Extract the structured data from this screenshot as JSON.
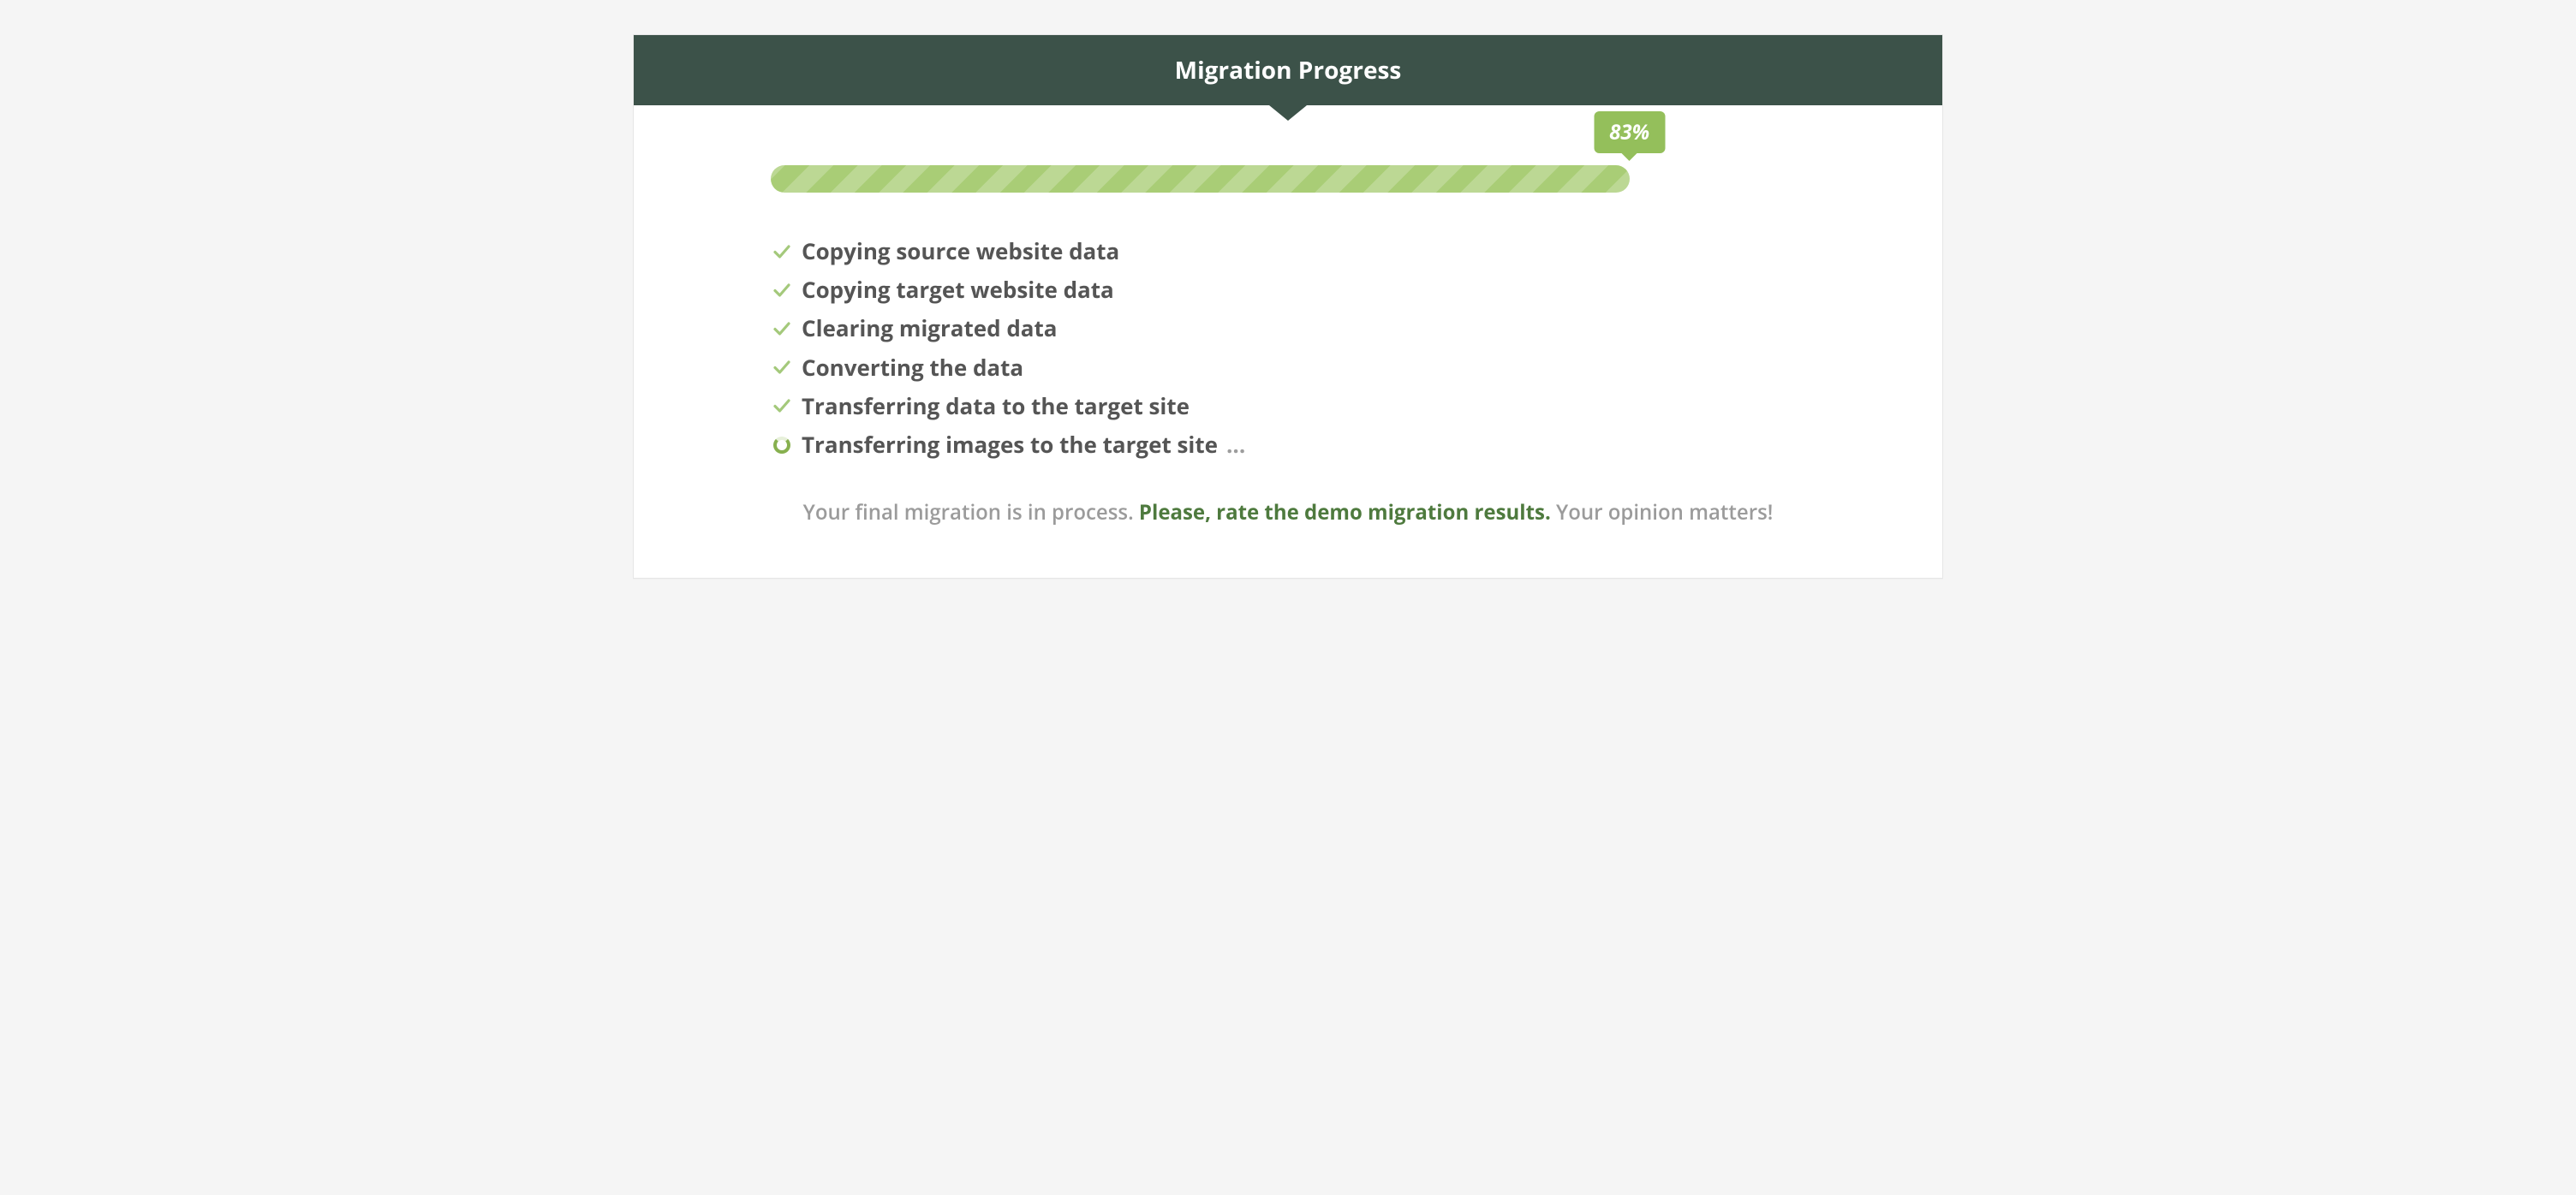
{
  "header": {
    "title": "Migration Progress"
  },
  "progress": {
    "percent": 83,
    "badge_text": "83%"
  },
  "steps": [
    {
      "status": "done",
      "label": "Copying source website data"
    },
    {
      "status": "done",
      "label": "Copying target website data"
    },
    {
      "status": "done",
      "label": "Clearing migrated data"
    },
    {
      "status": "done",
      "label": "Converting the data"
    },
    {
      "status": "done",
      "label": "Transferring data to the target site"
    },
    {
      "status": "running",
      "label": "Transferring images to the target site",
      "ellipsis": "..."
    }
  ],
  "footer": {
    "lead": "Your final migration is in process. ",
    "link": "Please, rate the demo migration results.",
    "trail": " Your opinion matters!"
  },
  "colors": {
    "header_bg": "#3c5249",
    "accent": "#a4c97b",
    "badge": "#94bf5b"
  }
}
